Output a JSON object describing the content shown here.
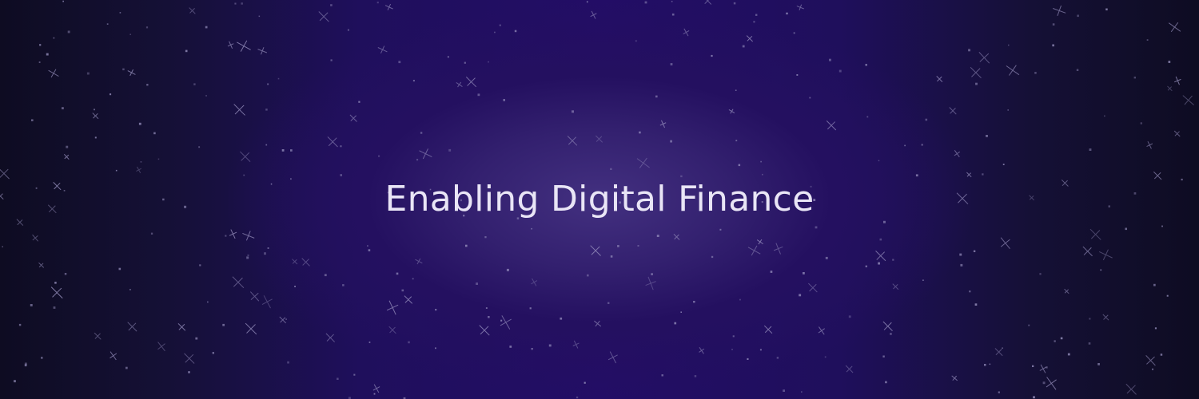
{
  "banner": {
    "headline": "Enabling Digital Finance",
    "background_icon": "starfield-sparkle-icon",
    "colors": {
      "center_glow": "#433080",
      "mid_purple": "#230d66",
      "edge_dark": "#0e0c22",
      "text": "#e9e5f6",
      "sparkle": "#9a93c0"
    }
  }
}
